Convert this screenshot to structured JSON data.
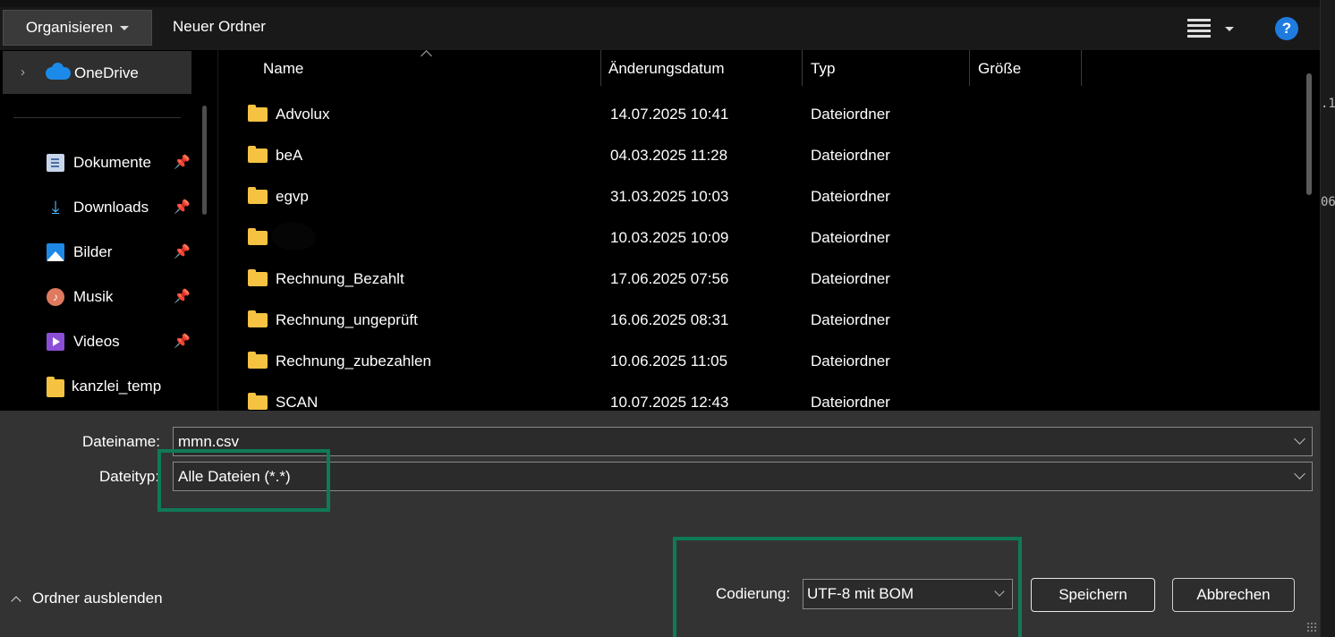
{
  "toolbar": {
    "organize_label": "Organisieren",
    "new_folder_label": "Neuer Ordner",
    "view_icon": "view-list-icon",
    "help_label": "?"
  },
  "nav": {
    "onedrive_label": "OneDrive",
    "items": [
      {
        "label": "Dokumente",
        "icon": "document-icon",
        "pinned": true
      },
      {
        "label": "Downloads",
        "icon": "download-icon",
        "pinned": true
      },
      {
        "label": "Bilder",
        "icon": "pictures-icon",
        "pinned": true
      },
      {
        "label": "Musik",
        "icon": "music-icon",
        "pinned": true
      },
      {
        "label": "Videos",
        "icon": "videos-icon",
        "pinned": true
      },
      {
        "label": "kanzlei_temp",
        "icon": "folder-icon",
        "pinned": false
      }
    ]
  },
  "columns": {
    "name": "Name",
    "date": "Änderungsdatum",
    "type": "Typ",
    "size": "Größe"
  },
  "files": [
    {
      "name": "Advolux",
      "date": "14.07.2025 10:41",
      "type": "Dateiordner"
    },
    {
      "name": "beA",
      "date": "04.03.2025 11:28",
      "type": "Dateiordner"
    },
    {
      "name": "egvp",
      "date": "31.03.2025 10:03",
      "type": "Dateiordner"
    },
    {
      "name": "",
      "date": "10.03.2025 10:09",
      "type": "Dateiordner"
    },
    {
      "name": "Rechnung_Bezahlt",
      "date": "17.06.2025 07:56",
      "type": "Dateiordner"
    },
    {
      "name": "Rechnung_ungeprüft",
      "date": "16.06.2025 08:31",
      "type": "Dateiordner"
    },
    {
      "name": "Rechnung_zubezahlen",
      "date": "10.06.2025 11:05",
      "type": "Dateiordner"
    },
    {
      "name": "SCAN",
      "date": "10.07.2025 12:43",
      "type": "Dateiordner"
    }
  ],
  "form": {
    "filename_label": "Dateiname:",
    "filename_value": "mmn.csv",
    "filetype_label": "Dateityp:",
    "filetype_value": "Alle Dateien  (*.*)",
    "encoding_label": "Codierung:",
    "encoding_value": "UTF-8 mit BOM"
  },
  "footer": {
    "toggle_folders_label": "Ordner ausblenden",
    "save_label": "Speichern",
    "cancel_label": "Abbrechen"
  },
  "background_text": [
    ".1",
    "06"
  ],
  "colors": {
    "accent": "#1e7be0",
    "highlight_box": "#0f7a57",
    "folder": "#f5c242"
  }
}
